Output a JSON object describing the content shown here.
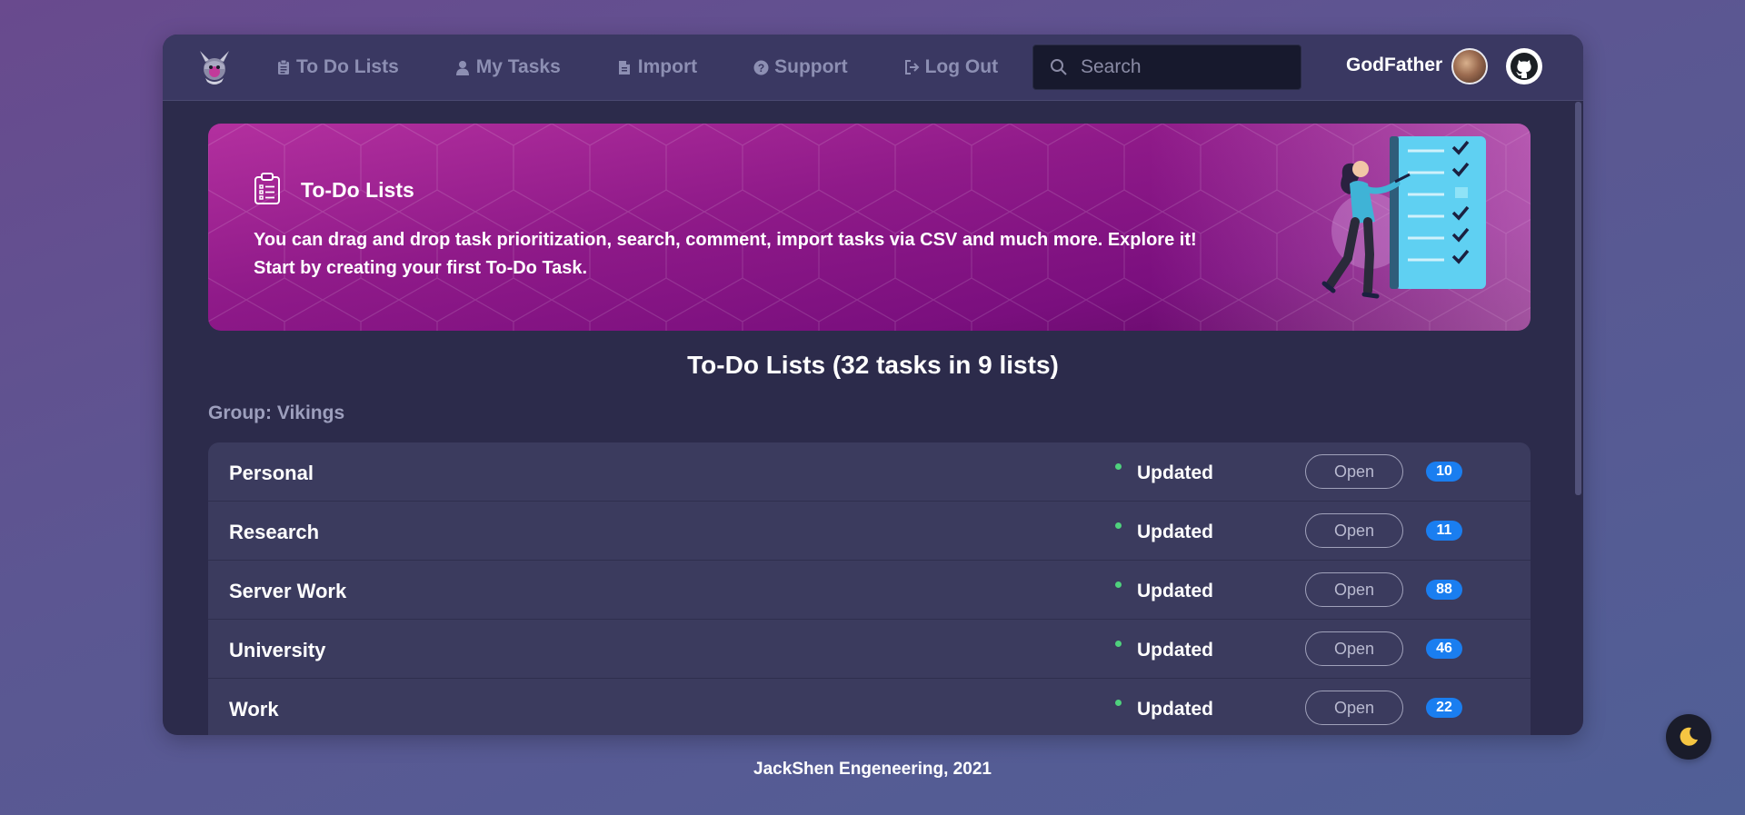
{
  "navbar": {
    "logo_icon": "viking-mascot-icon",
    "links": [
      {
        "label": "To Do Lists",
        "icon": "clipboard-icon"
      },
      {
        "label": "My Tasks",
        "icon": "user-icon"
      },
      {
        "label": "Import",
        "icon": "file-icon"
      },
      {
        "label": "Support",
        "icon": "question-circle-icon"
      },
      {
        "label": "Log Out",
        "icon": "sign-out-icon"
      }
    ],
    "search": {
      "placeholder": "Search",
      "value": ""
    },
    "username": "GodFather"
  },
  "banner": {
    "title": "To-Do Lists",
    "line1": "You can drag and drop task prioritization, search, comment, import tasks via CSV and much more. Explore it!",
    "line2": "Start by creating your first To-Do Task."
  },
  "main": {
    "heading": "To-Do Lists (32 tasks in 9 lists)",
    "group_label": "Group: Vikings",
    "lists": [
      {
        "name": "Personal",
        "status": "Updated",
        "open_label": "Open",
        "count": "10"
      },
      {
        "name": "Research",
        "status": "Updated",
        "open_label": "Open",
        "count": "11"
      },
      {
        "name": "Server Work",
        "status": "Updated",
        "open_label": "Open",
        "count": "88"
      },
      {
        "name": "University",
        "status": "Updated",
        "open_label": "Open",
        "count": "46"
      },
      {
        "name": "Work",
        "status": "Updated",
        "open_label": "Open",
        "count": "22"
      }
    ]
  },
  "footer": {
    "text": "JackShen Engeneering, 2021"
  },
  "colors": {
    "accent_badge": "#1a7ef0",
    "status_dot": "#4fd17d",
    "banner": "#8f1a89",
    "moon": "#f5c542"
  }
}
